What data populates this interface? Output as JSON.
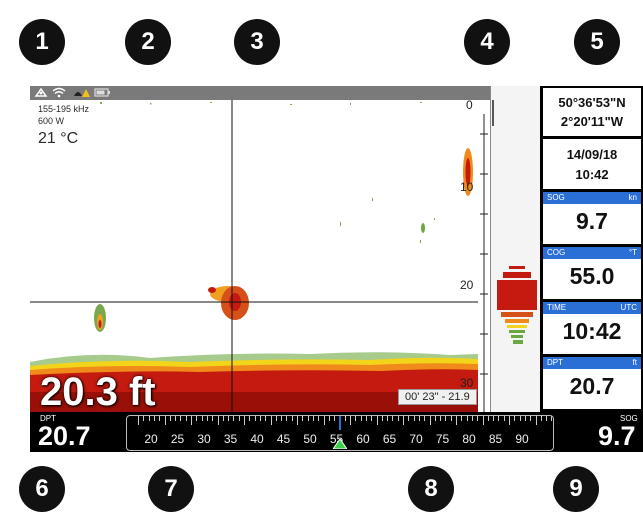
{
  "callouts": [
    "1",
    "2",
    "3",
    "4",
    "5",
    "6",
    "7",
    "8",
    "9"
  ],
  "status_icons": [
    "antenna-icon",
    "wifi-icon",
    "alarm-warning-icon",
    "battery-icon"
  ],
  "sonar": {
    "frequency": "155-195 kHz",
    "power": "600 W",
    "water_temp": "21 °C",
    "depth_big": "20.3 ft",
    "cursor_readout": "00' 23\" - 21.9",
    "scale_labels": [
      "0",
      "10",
      "20",
      "30"
    ]
  },
  "panels": {
    "position_lat": "50°36'53\"N",
    "position_lon": "2°20'11\"W",
    "date": "14/09/18",
    "time_small": "10:42",
    "sog_label": "SOG",
    "sog_unit": "kn",
    "sog_value": "9.7",
    "cog_label": "COG",
    "cog_unit": "°T",
    "cog_value": "55.0",
    "time_label": "TIME",
    "time_unit": "UTC",
    "time_value": "10:42",
    "dpt_label": "DPT",
    "dpt_unit": "ft",
    "dpt_value": "20.7"
  },
  "footer": {
    "dpt_label": "DPT",
    "dpt_value": "20.7",
    "sog_label": "SOG",
    "sog_value": "9.7",
    "compass_numbers": [
      "20",
      "25",
      "30",
      "35",
      "40",
      "45",
      "50",
      "55",
      "60",
      "65",
      "70",
      "75",
      "80",
      "85",
      "90"
    ],
    "heading_value": 55
  },
  "colors": {
    "bottom_red": "#c41a10",
    "bottom_orange": "#f08a1a",
    "bottom_yellow": "#f2d41a",
    "panel_header_blue": "#2a6fd6",
    "heading_marker": "#3bd14a"
  }
}
